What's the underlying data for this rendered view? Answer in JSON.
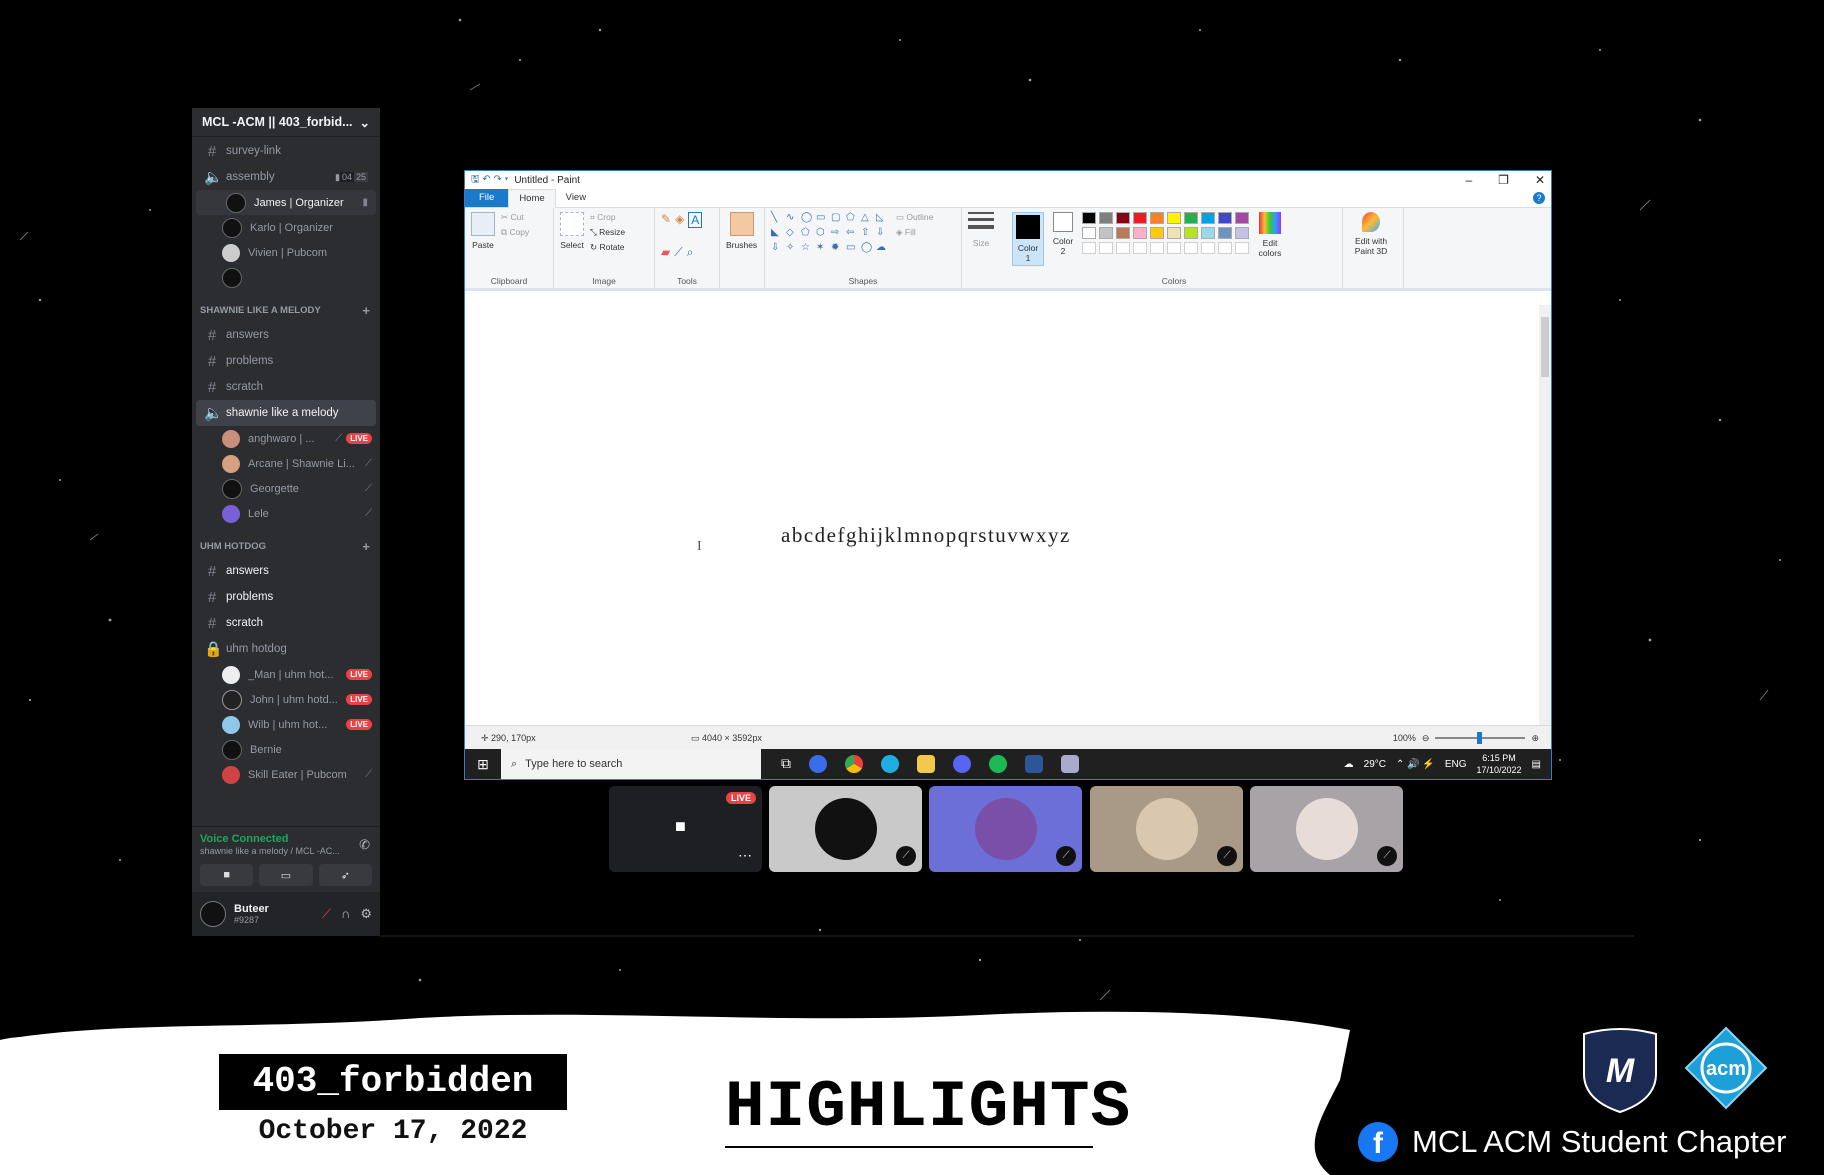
{
  "discord": {
    "server_name": "MCL -ACM || 403_forbid...",
    "top_channels": [
      {
        "name": "survey-link",
        "type": "text"
      }
    ],
    "assembly": {
      "name": "assembly",
      "count_a": "04",
      "count_b": "25",
      "users": [
        "James | Organizer",
        "Karlo | Organizer",
        "Vivien | Pubcom",
        ""
      ]
    },
    "category1": {
      "name": "SHAWNIE LIKE A MELODY",
      "channels": [
        "answers",
        "problems",
        "scratch"
      ],
      "voice": "shawnie like a melody",
      "users": [
        {
          "name": "anghwaro | ...",
          "live": "LIVE"
        },
        {
          "name": "Arcane | Shawnie Li...",
          "live": ""
        },
        {
          "name": "Georgette",
          "live": ""
        },
        {
          "name": "Lele",
          "live": ""
        }
      ]
    },
    "category2": {
      "name": "UHM HOTDOG",
      "channels": [
        "answers",
        "problems",
        "scratch"
      ],
      "voice": "uhm hotdog",
      "users": [
        {
          "name": "_Man | uhm hot...",
          "live": "LIVE"
        },
        {
          "name": "John | uhm hotd...",
          "live": "LIVE"
        },
        {
          "name": "Wilb | uhm hot...",
          "live": "LIVE"
        },
        {
          "name": "Bernie",
          "live": ""
        },
        {
          "name": "Skill Eater | Pubcom",
          "live": ""
        }
      ]
    },
    "voice_status": "Voice Connected",
    "voice_location": "shawnie like a melody / MCL -AC...",
    "user": {
      "name": "Buteer",
      "tag": "#9287"
    }
  },
  "paint": {
    "title": "Untitled - Paint",
    "tabs": [
      "File",
      "Home",
      "View"
    ],
    "groups": {
      "clipboard": {
        "label": "Clipboard",
        "paste": "Paste",
        "cut": "Cut",
        "copy": "Copy"
      },
      "image": {
        "label": "Image",
        "select": "Select",
        "crop": "Crop",
        "resize": "Resize",
        "rotate": "Rotate"
      },
      "tools": {
        "label": "Tools"
      },
      "brushes": "Brushes",
      "shapes": {
        "label": "Shapes",
        "outline": "Outline",
        "fill": "Fill"
      },
      "size": "Size",
      "color1": "Color 1",
      "color2": "Color 2",
      "colors": {
        "label": "Colors"
      },
      "edit_colors": "Edit colors",
      "paint3d": "Edit with Paint 3D"
    },
    "palette": [
      "#000000",
      "#7f7f7f",
      "#880015",
      "#ed1c24",
      "#ff7f27",
      "#fff200",
      "#22b14c",
      "#00a2e8",
      "#3f48cc",
      "#a349a4",
      "#ffffff",
      "#c3c3c3",
      "#b97a57",
      "#ffaec9",
      "#ffc90e",
      "#efe4b0",
      "#b5e61d",
      "#99d9ea",
      "#7092be",
      "#c8bfe7"
    ],
    "canvas_text": "abcdefghijklmnopqrstuvwxyz",
    "status": {
      "position": "290, 170px",
      "dimensions": "4040 × 3592px",
      "zoom": "100%",
      "zoom_level": 0.5
    }
  },
  "taskbar": {
    "search_placeholder": "Type here to search",
    "weather": "29°C",
    "lang": "ENG",
    "time": "6:15 PM",
    "date": "17/10/2022"
  },
  "tiles": [
    {
      "kind": "screen",
      "live": "LIVE",
      "bg": "#1e1f22"
    },
    {
      "kind": "avatar",
      "bg": "#c9c9c9",
      "avatar": "#111111"
    },
    {
      "kind": "avatar",
      "bg": "#6c6fd8",
      "avatar": "#7a4fa8"
    },
    {
      "kind": "avatar",
      "bg": "#a89a86",
      "avatar": "#d9c7b0"
    },
    {
      "kind": "avatar",
      "bg": "#a7a3a6",
      "avatar": "#e8dcd8"
    }
  ],
  "banner": {
    "team": "403_forbidden",
    "date": "October 17, 2022",
    "headline": "HIGHLIGHTS",
    "org": "MCL ACM Student Chapter",
    "fb_glyph": "f",
    "logo1": "M",
    "logo2": "acm"
  }
}
